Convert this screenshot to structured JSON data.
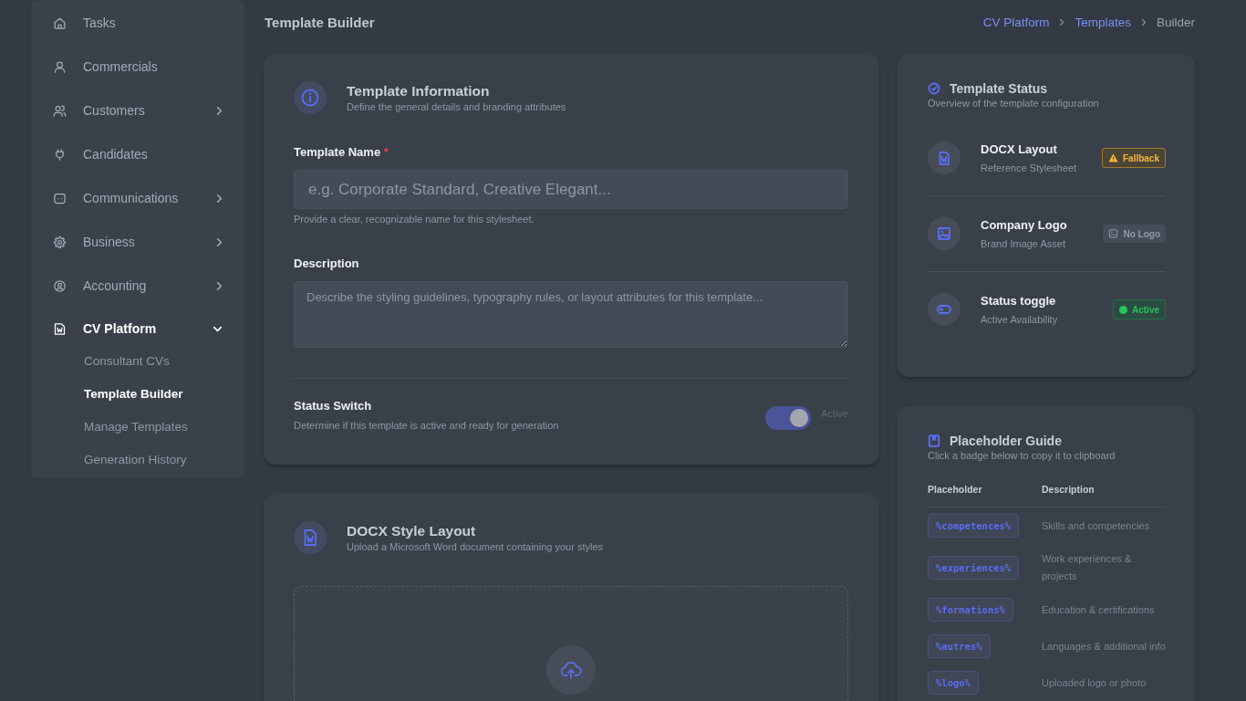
{
  "sidebar": {
    "items": [
      {
        "label": "Tasks",
        "kind": "link",
        "selected": false
      },
      {
        "label": "Commercials",
        "kind": "link",
        "selected": false
      },
      {
        "label": "Customers",
        "kind": "group",
        "expanded": false,
        "selected": false
      },
      {
        "label": "Candidates",
        "kind": "link",
        "selected": false
      },
      {
        "label": "Communications",
        "kind": "group",
        "expanded": false,
        "selected": false
      },
      {
        "label": "Business",
        "kind": "group",
        "expanded": false,
        "selected": false
      },
      {
        "label": "Accounting",
        "kind": "group",
        "expanded": false,
        "selected": false
      },
      {
        "label": "CV Platform",
        "kind": "group",
        "expanded": true,
        "selected": true,
        "children": [
          {
            "label": "Consultant CVs",
            "selected": false
          },
          {
            "label": "Template Builder",
            "selected": true
          },
          {
            "label": "Manage Templates",
            "selected": false
          },
          {
            "label": "Generation History",
            "selected": false
          }
        ]
      }
    ]
  },
  "header": {
    "title": "Template Builder",
    "breadcrumb": [
      {
        "label": "CV Platform",
        "link": true
      },
      {
        "label": "Templates",
        "link": true
      },
      {
        "label": "Builder",
        "link": false
      }
    ]
  },
  "info_card": {
    "title": "Template Information",
    "subtitle": "Define the general details and branding attributes",
    "fields": [
      {
        "kind": "input",
        "label": "Template Name",
        "required_mark": "*",
        "placeholder": "e.g. Corporate Standard, Creative Elegant...",
        "help": "Provide a clear, recognizable name for this stylesheet."
      },
      {
        "kind": "textarea",
        "label": "Description",
        "placeholder": "Describe the styling guidelines, typography rules, or layout attributes for this template..."
      }
    ],
    "status_switch": {
      "label": "Status Switch",
      "help": "Determine if this template is active and ready for generation",
      "on": true,
      "state_label": "Active"
    }
  },
  "docx_card": {
    "title": "DOCX Style Layout",
    "subtitle": "Upload a Microsoft Word document containing your styles"
  },
  "status_card": {
    "title": "Template Status",
    "subtitle": "Overview of the template configuration",
    "rows": [
      {
        "title": "DOCX Layout",
        "subtitle": "Reference Stylesheet",
        "badge": {
          "label": "Fallback",
          "kind": "warning"
        }
      },
      {
        "title": "Company Logo",
        "subtitle": "Brand Image Asset",
        "badge": {
          "label": "No Logo",
          "kind": "muted"
        }
      },
      {
        "title": "Status toggle",
        "subtitle": "Active Availability",
        "badge": {
          "label": "Active",
          "kind": "success"
        }
      }
    ]
  },
  "guide_card": {
    "title": "Placeholder Guide",
    "subtitle": "Click a badge below to copy it to clipboard",
    "columns": [
      "Placeholder",
      "Description"
    ],
    "rows": [
      {
        "placeholder": "%competences%",
        "description": "Skills and competencies"
      },
      {
        "placeholder": "%experiences%",
        "description": "Work experiences & projects"
      },
      {
        "placeholder": "%formations%",
        "description": "Education & certifications"
      },
      {
        "placeholder": "%autres%",
        "description": "Languages & additional info"
      },
      {
        "placeholder": "%logo%",
        "description": "Uploaded logo or photo"
      }
    ]
  }
}
